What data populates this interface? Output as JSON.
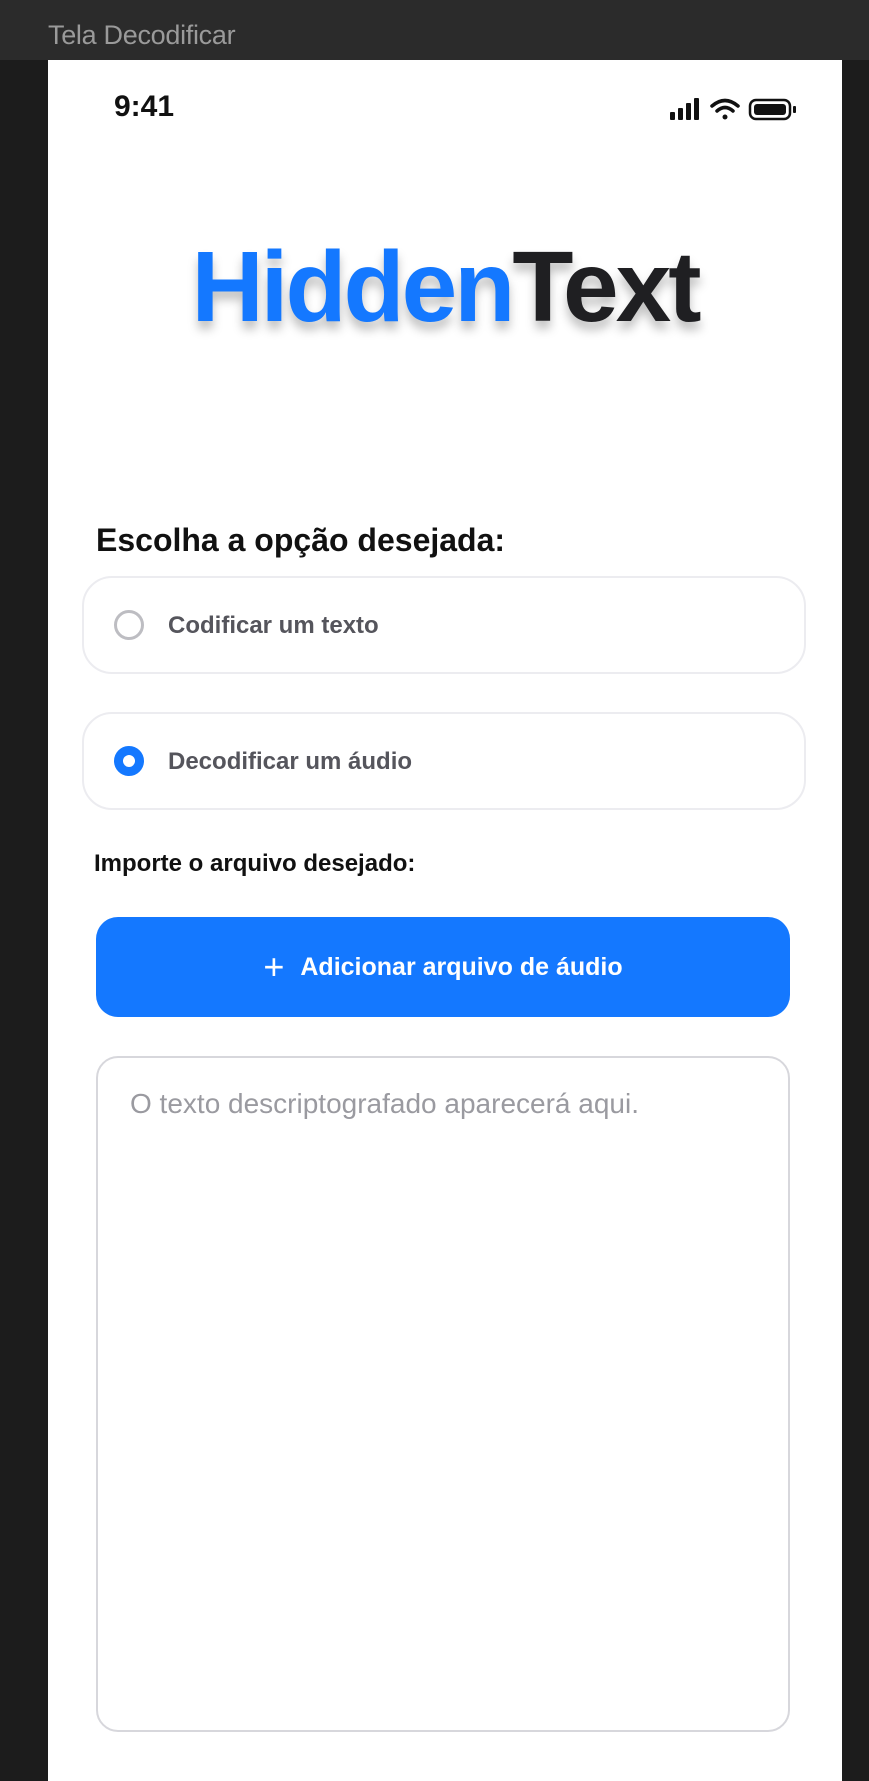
{
  "window": {
    "frame_title": "Tela Decodificar"
  },
  "status_bar": {
    "time": "9:41",
    "icons": [
      "cellular-signal-icon",
      "wifi-icon",
      "battery-icon"
    ]
  },
  "header": {
    "title_part1": "Hidden",
    "title_part2": "Text"
  },
  "main": {
    "prompt": "Escolha a opção desejada:",
    "options": [
      {
        "label": "Codificar um texto",
        "selected": false
      },
      {
        "label": "Decodificar um áudio",
        "selected": true
      }
    ],
    "import_label": "Importe o arquivo desejado:",
    "add_button_icon": "+",
    "add_button_label": "Adicionar arquivo de áudio",
    "output_placeholder": "O texto descriptografado aparecerá aqui."
  },
  "colors": {
    "accent": "#1478FF",
    "title_dark": "#1F1F22",
    "background": "#FFFFFF"
  }
}
